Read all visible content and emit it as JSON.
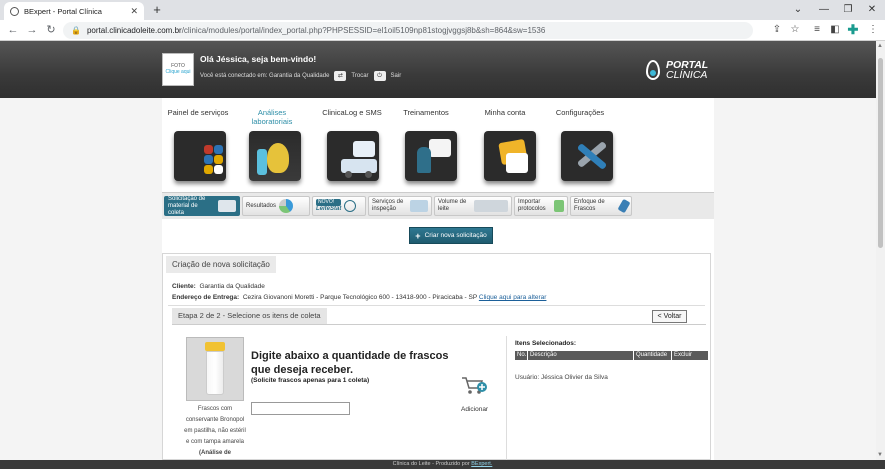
{
  "browser": {
    "tab_title": "BExpert - Portal Clínica",
    "url_host": "portal.clinicadoleite.com.br",
    "url_path": "/clinica/modules/portal/index_portal.php?PHPSESSID=el1oil5109np81stogjvggsj8b&sh=864&sw=1536"
  },
  "header": {
    "photo_line1": "FOTO",
    "photo_line2": "Clique aqui",
    "greeting": "Olá Jéssica, seja bem-vindo!",
    "connected_label": "Você está conectado em: Garantia da Qualidade",
    "trocar": "Trocar",
    "sair": "Sair",
    "logo_line1": "PORTAL",
    "logo_line2": "CLÍNICA"
  },
  "menu": [
    {
      "label": "Painel de serviços"
    },
    {
      "label": "Análises laboratoriais"
    },
    {
      "label": "ClinicaLog e SMS"
    },
    {
      "label": "Treinamentos"
    },
    {
      "label": "Minha conta"
    },
    {
      "label": "Configurações"
    }
  ],
  "submenu": [
    {
      "label": "Solicitação de material de coleta"
    },
    {
      "label": "Resultados"
    },
    {
      "label": "LeiteStat",
      "badge": "NOVO!"
    },
    {
      "label": "Serviços de inspeção"
    },
    {
      "label": "Volume de leite"
    },
    {
      "label": "Importar protocolos"
    },
    {
      "label": "Enfoque de Frascos"
    }
  ],
  "actions": {
    "new_request": "Criar nova solicitação"
  },
  "form": {
    "title": "Criação de nova solicitação",
    "cliente_label": "Cliente:",
    "cliente_value": "Garantia da Qualidade",
    "endereco_label": "Endereço de Entrega:",
    "endereco_value": "Cezira Giovanoni Moretti - Parque Tecnológico  600 - 13418-900 - Piracicaba - SP",
    "endereco_link": "Clique aqui para alterar",
    "step": "Etapa 2 de 2 - Selecione os itens de coleta",
    "voltar": "< Voltar",
    "product_desc": "Frascos com conservante Bronopol em pastilha, não estéril e com tampa amarela",
    "product_note": "(Análise de CCS/Composição/...)",
    "qty_title": "Digite abaixo a quantidade de frascos que deseja receber.",
    "qty_sub": "(Solicite frascos apenas para 1 coleta)",
    "qty_value": "",
    "add_label": "Adicionar",
    "selected_title": "Itens Selecionados:",
    "columns": [
      "No.",
      "Descrição",
      "Quantidade",
      "Excluir"
    ],
    "user_line": "Usuário: Jéssica Olivier da Silva"
  },
  "footer": {
    "text": "Clínica do Leite - Produzido por",
    "link": "BExpert."
  }
}
